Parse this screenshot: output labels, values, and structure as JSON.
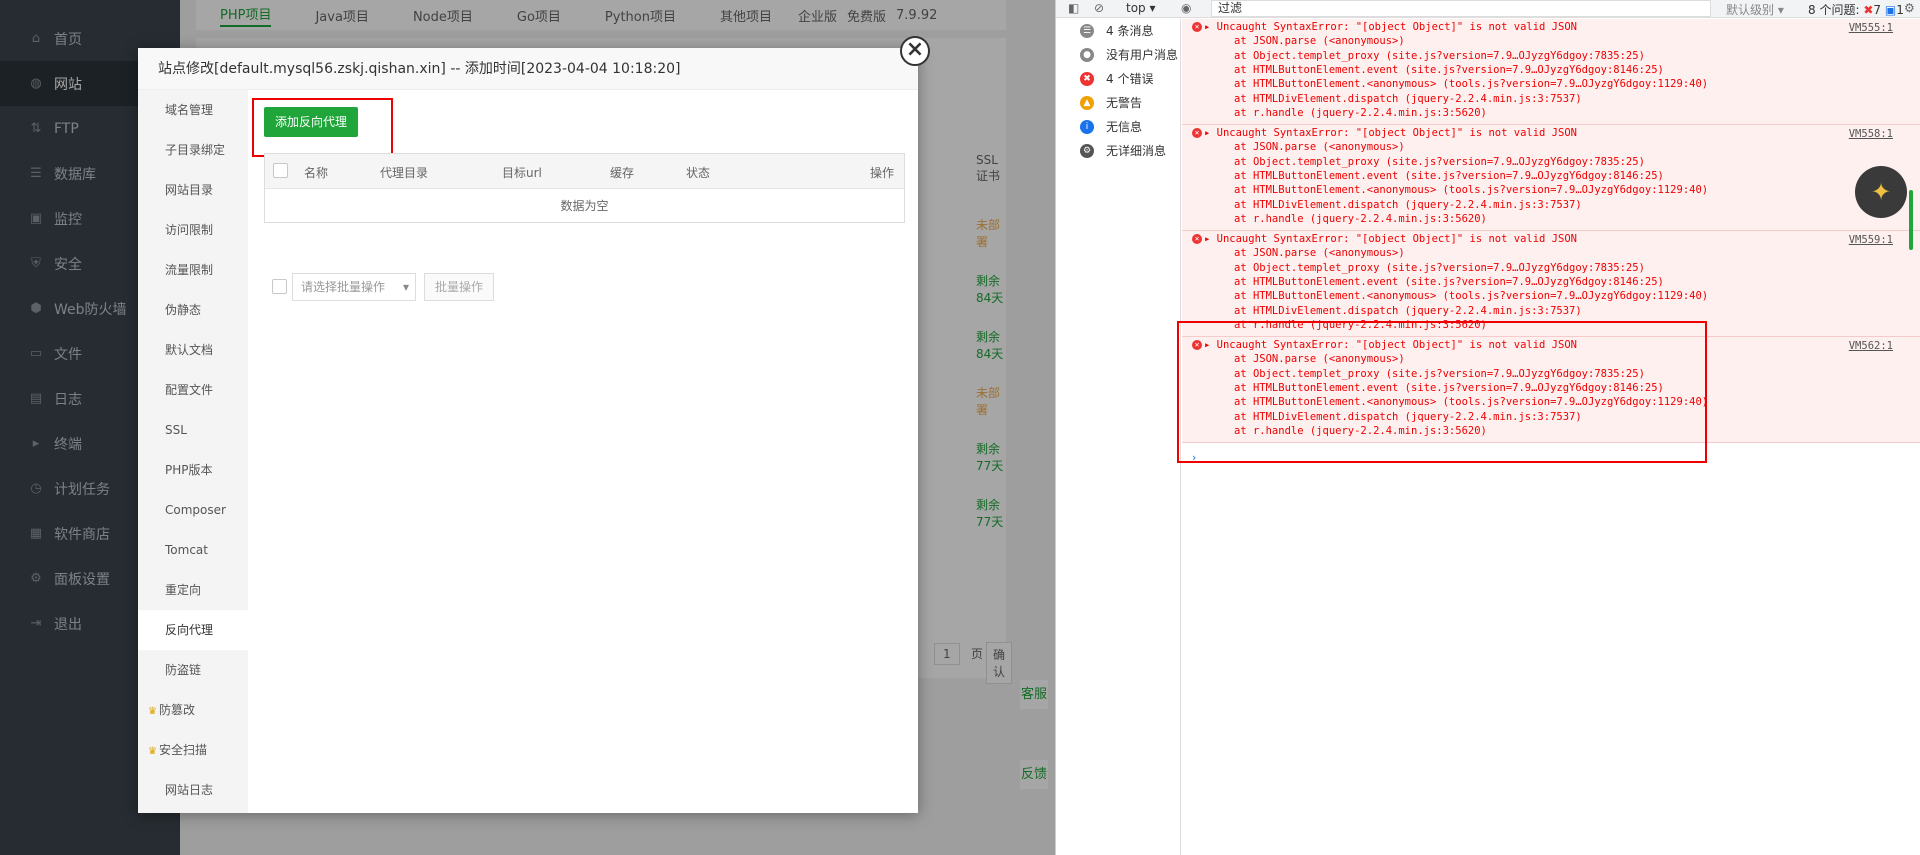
{
  "sidebar": {
    "items": [
      {
        "label": "首页",
        "icon": "home-icon",
        "glyph": "⌂"
      },
      {
        "label": "网站",
        "icon": "globe-icon",
        "glyph": "◍",
        "active": true
      },
      {
        "label": "FTP",
        "icon": "ftp-icon",
        "glyph": "⇅"
      },
      {
        "label": "数据库",
        "icon": "database-icon",
        "glyph": "☰"
      },
      {
        "label": "监控",
        "icon": "monitor-icon",
        "glyph": "▣"
      },
      {
        "label": "安全",
        "icon": "shield-icon",
        "glyph": "⛨"
      },
      {
        "label": "Web防火墙",
        "icon": "firewall-icon",
        "glyph": "⬢"
      },
      {
        "label": "文件",
        "icon": "folder-icon",
        "glyph": "▭"
      },
      {
        "label": "日志",
        "icon": "log-icon",
        "glyph": "▤"
      },
      {
        "label": "终端",
        "icon": "terminal-icon",
        "glyph": "▸"
      },
      {
        "label": "计划任务",
        "icon": "cron-icon",
        "glyph": "◷"
      },
      {
        "label": "软件商店",
        "icon": "store-icon",
        "glyph": "▦"
      },
      {
        "label": "面板设置",
        "icon": "settings-icon",
        "glyph": "⚙"
      },
      {
        "label": "退出",
        "icon": "logout-icon",
        "glyph": "⇥"
      }
    ]
  },
  "main": {
    "tabs": [
      "PHP项目",
      "Java项目",
      "Node项目",
      "Go项目",
      "Python项目",
      "其他项目"
    ],
    "edition": "企业版",
    "free_label": "免费版",
    "version": "7.9.92",
    "ssl_header": "SSL证书",
    "ssl_statuses": [
      "未部署",
      "剩余84天",
      "剩余84天",
      "未部署",
      "剩余77天",
      "剩余77天"
    ],
    "page_number": "1",
    "page_unit": "页",
    "confirm_label": "确认",
    "cs_label": "客服",
    "feedback_label": "反馈"
  },
  "dialog": {
    "title": "站点修改[default.mysql56.zskj.qishan.xin] -- 添加时间[2023-04-04 10:18:20]",
    "nav": [
      "域名管理",
      "子目录绑定",
      "网站目录",
      "访问限制",
      "流量限制",
      "伪静态",
      "默认文档",
      "配置文件",
      "SSL",
      "PHP版本",
      "Composer",
      "Tomcat",
      "重定向",
      "反向代理",
      "防盗链",
      "防篡改",
      "安全扫描",
      "网站日志"
    ],
    "add_button": "添加反向代理",
    "columns": [
      "名称",
      "代理目录",
      "目标url",
      "缓存",
      "状态",
      "操作"
    ],
    "empty_text": "数据为空",
    "batch_placeholder": "请选择批量操作",
    "batch_button": "批量操作"
  },
  "devtools": {
    "context": "top",
    "filter_placeholder": "过滤",
    "level_label": "默认级别",
    "issues_label": "8 个问题:",
    "issues_errors": "7",
    "issues_info": "1",
    "side": [
      {
        "label": "4 条消息",
        "icon": "list-icon"
      },
      {
        "label": "没有用户消息",
        "icon": "user-icon"
      },
      {
        "label": "4 个错误",
        "icon": "error-icon"
      },
      {
        "label": "无警告",
        "icon": "warning-icon"
      },
      {
        "label": "无信息",
        "icon": "info-icon"
      },
      {
        "label": "无详细消息",
        "icon": "verbose-icon"
      }
    ],
    "errors": [
      {
        "vm": "VM555:1",
        "lines": [
          "Uncaught SyntaxError: \"[object Object]\" is not valid JSON",
          "at JSON.parse (<anonymous>)",
          "at Object.templet_proxy (site.js?version=7.9…OJyzgY6dgoy:7835:25)",
          "at HTMLButtonElement.event (site.js?version=7.9…OJyzgY6dgoy:8146:25)",
          "at HTMLButtonElement.<anonymous> (tools.js?version=7.9…OJyzgY6dgoy:1129:40)",
          "at HTMLDivElement.dispatch (jquery-2.2.4.min.js:3:7537)",
          "at r.handle (jquery-2.2.4.min.js:3:5620)"
        ]
      },
      {
        "vm": "VM558:1",
        "lines": [
          "Uncaught SyntaxError: \"[object Object]\" is not valid JSON",
          "at JSON.parse (<anonymous>)",
          "at Object.templet_proxy (site.js?version=7.9…OJyzgY6dgoy:7835:25)",
          "at HTMLButtonElement.event (site.js?version=7.9…OJyzgY6dgoy:8146:25)",
          "at HTMLButtonElement.<anonymous> (tools.js?version=7.9…OJyzgY6dgoy:1129:40)",
          "at HTMLDivElement.dispatch (jquery-2.2.4.min.js:3:7537)",
          "at r.handle (jquery-2.2.4.min.js:3:5620)"
        ]
      },
      {
        "vm": "VM559:1",
        "lines": [
          "Uncaught SyntaxError: \"[object Object]\" is not valid JSON",
          "at JSON.parse (<anonymous>)",
          "at Object.templet_proxy (site.js?version=7.9…OJyzgY6dgoy:7835:25)",
          "at HTMLButtonElement.event (site.js?version=7.9…OJyzgY6dgoy:8146:25)",
          "at HTMLButtonElement.<anonymous> (tools.js?version=7.9…OJyzgY6dgoy:1129:40)",
          "at HTMLDivElement.dispatch (jquery-2.2.4.min.js:3:7537)",
          "at r.handle (jquery-2.2.4.min.js:3:5620)"
        ]
      },
      {
        "vm": "VM562:1",
        "lines": [
          "Uncaught SyntaxError: \"[object Object]\" is not valid JSON",
          "at JSON.parse (<anonymous>)",
          "at Object.templet_proxy (site.js?version=7.9…OJyzgY6dgoy:7835:25)",
          "at HTMLButtonElement.event (site.js?version=7.9…OJyzgY6dgoy:8146:25)",
          "at HTMLButtonElement.<anonymous> (tools.js?version=7.9…OJyzgY6dgoy:1129:40)",
          "at HTMLDivElement.dispatch (jquery-2.2.4.min.js:3:7537)",
          "at r.handle (jquery-2.2.4.min.js:3:5620)"
        ]
      }
    ],
    "prompt_glyph": "›"
  },
  "colors": {
    "accent": "#20a53a",
    "sidebar": "#3c444d",
    "error": "#e00000",
    "highlight": "#ee0000"
  }
}
